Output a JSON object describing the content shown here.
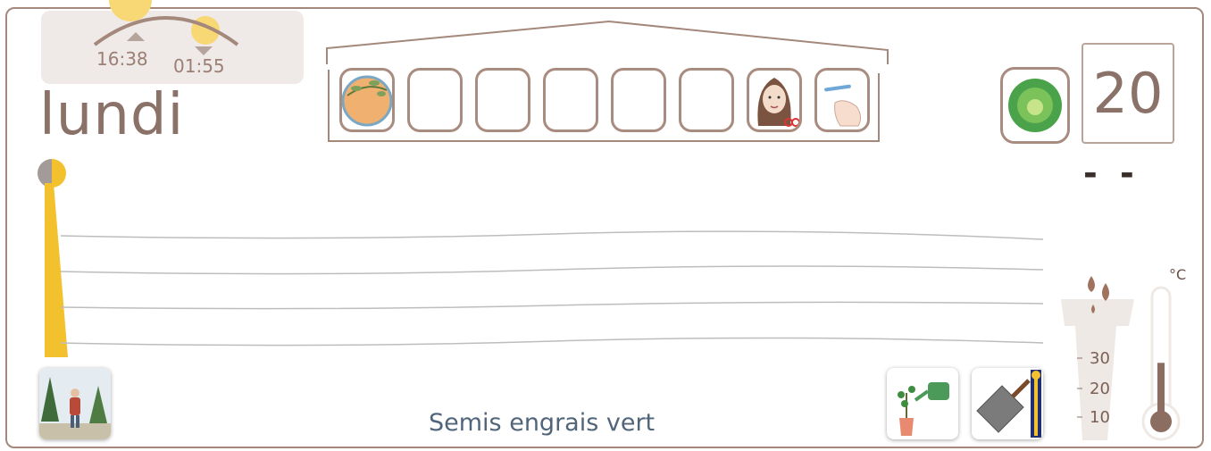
{
  "sun": {
    "sunset_time": "16:38",
    "sunrise_time": "01:55",
    "sun_color": "#f8d775",
    "arc_color": "#a4887b"
  },
  "day": {
    "name": "lundi"
  },
  "activity_strip": {
    "tiles": [
      {
        "icon": "plant-bowl-icon",
        "filled": true
      },
      {
        "icon": "empty-slot",
        "filled": false
      },
      {
        "icon": "empty-slot",
        "filled": false
      },
      {
        "icon": "empty-slot",
        "filled": false
      },
      {
        "icon": "empty-slot",
        "filled": false
      },
      {
        "icon": "empty-slot",
        "filled": false
      },
      {
        "icon": "haircut-icon",
        "filled": true
      },
      {
        "icon": "hand-toothbrush-icon",
        "filled": true
      }
    ]
  },
  "vegetable": {
    "icon": "lettuce-icon"
  },
  "counter": {
    "value": "20",
    "sub": "- -"
  },
  "moon": {
    "icon": "half-moon-icon"
  },
  "day_progress": {
    "fraction": 1.0,
    "color": "#f4c12e"
  },
  "caption": {
    "text": "Semis engrais vert"
  },
  "bottom_buttons": {
    "hiking": {
      "icon": "hiking-icon"
    },
    "watering": {
      "icon": "watering-can-icon"
    },
    "spade": {
      "icon": "spade-icon"
    }
  },
  "rain_gauge": {
    "icon": "rain-drops-icon",
    "labels": [
      "30",
      "20",
      "10"
    ]
  },
  "thermometer": {
    "unit": "°C",
    "level": 0.45,
    "color": "#8c6d62"
  }
}
